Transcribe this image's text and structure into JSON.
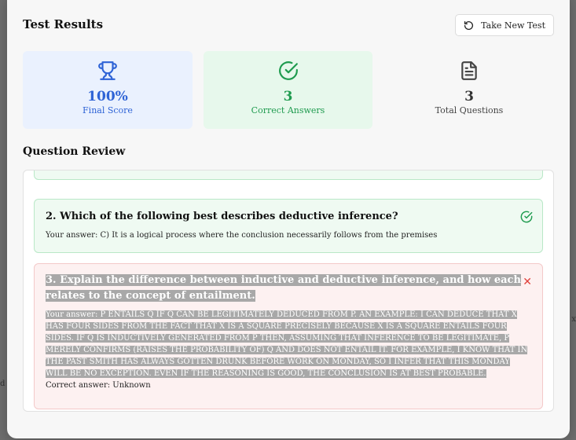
{
  "header": {
    "title": "Test Results",
    "new_test_label": "Take New Test"
  },
  "stats": {
    "score": {
      "value": "100%",
      "label": "Final Score",
      "icon": "trophy-icon"
    },
    "correct": {
      "value": "3",
      "label": "Correct Answers",
      "icon": "check-circle-icon"
    },
    "total": {
      "value": "3",
      "label": "Total Questions",
      "icon": "document-icon"
    }
  },
  "review": {
    "title": "Question Review",
    "questions": [
      {
        "text": "2. Which of the following best describes deductive inference?",
        "answer": "Your answer: C) It is a logical process where the conclusion necessarily follows from the premises",
        "status": "correct"
      },
      {
        "text": "3. Explain the difference between inductive and deductive inference, and how each relates to the concept of entailment.",
        "answer": "Your answer: P ENTAILS Q IF Q CAN BE LEGITIMATELY DEDUCED FROM P. AN EXAMPLE: I CAN DEDUCE THAT X HAS FOUR SIDES FROM THE FACT THAT X IS A SQUARE PRECISELY BECAUSE X IS A SQUARE ENTAILS FOUR SIDES. IF Q IS INDUCTIVELY GENERATED FROM P THEN, ASSUMING THAT INFERENCE TO BE LEGITIMATE, P MERELY CONFIRMS (RAISES THE PROBABILITY OF) Q AND DOES NOT ENTAIL IT. FOR EXAMPLE, I KNOW THAT IN THE PAST SMITH HAS ALWAYS GOTTEN DRUNK BEFORE WORK ON MONDAY, SO I INFER THAT THIS MONDAY WILL BE NO EXCEPTION. EVEN IF THE REASONING IS GOOD, THE CONCLUSION IS AT BEST PROBABLE.",
        "correct_answer": "Correct answer: Unknown",
        "status": "incorrect"
      }
    ]
  },
  "colors": {
    "blue": "#2e63d6",
    "green": "#1f9b4f",
    "red": "#e0413c"
  }
}
